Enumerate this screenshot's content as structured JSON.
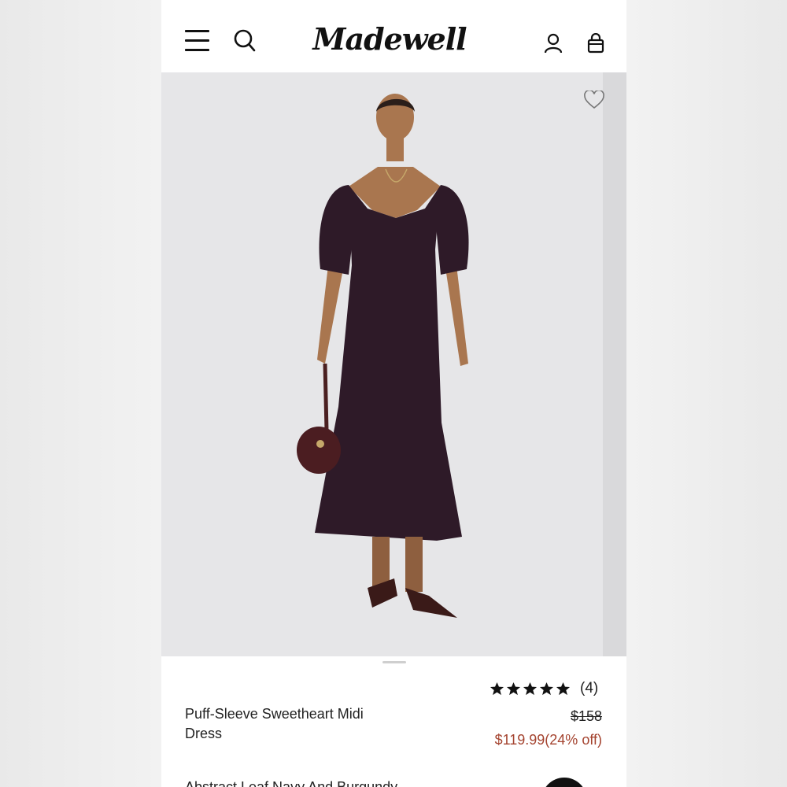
{
  "header": {
    "brand": "Madewell",
    "icons": [
      "menu-icon",
      "search-icon",
      "account-icon",
      "bag-icon"
    ]
  },
  "hero": {
    "image_subject": "model-photo",
    "favorite_icon": "heart-icon"
  },
  "product": {
    "name": "Puff-Sleeve Sweetheart Midi Dress",
    "rating": {
      "stars": 5,
      "count_label": "(4)"
    },
    "original_price": "$158",
    "sale_price": "$119.99(24% off)",
    "description_peek": "Abstract Leaf Navy And Burgundy"
  },
  "colors": {
    "sale_price": "#a4432f",
    "dress": "#2e1a28"
  }
}
